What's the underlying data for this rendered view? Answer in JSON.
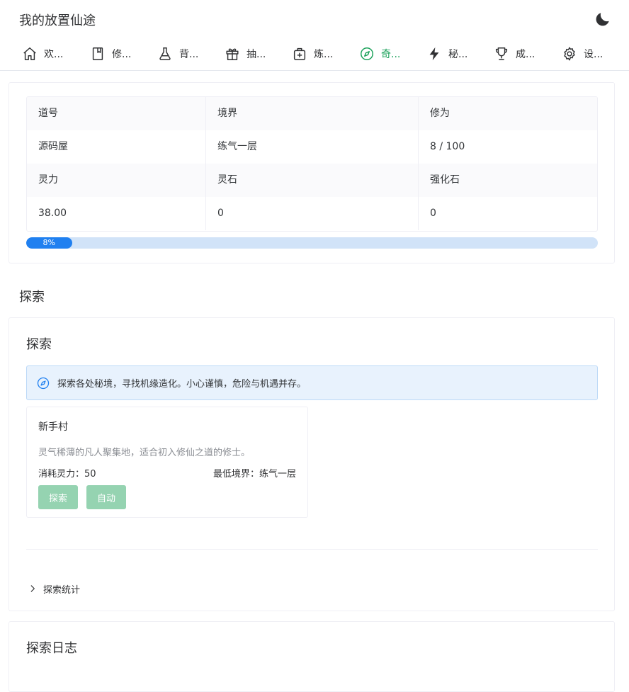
{
  "app": {
    "title": "我的放置仙途",
    "theme_icon": "moon-icon"
  },
  "nav": {
    "items": [
      {
        "label": "欢...",
        "icon": "home-icon"
      },
      {
        "label": "修...",
        "icon": "book-icon"
      },
      {
        "label": "背...",
        "icon": "flask-icon"
      },
      {
        "label": "抽...",
        "icon": "gift-icon"
      },
      {
        "label": "炼...",
        "icon": "medkit-icon"
      },
      {
        "label": "奇...",
        "icon": "compass-icon",
        "active": true
      },
      {
        "label": "秘...",
        "icon": "flash-icon"
      },
      {
        "label": "成...",
        "icon": "trophy-icon"
      },
      {
        "label": "设...",
        "icon": "gear-icon"
      }
    ],
    "active_color": "#18a058"
  },
  "stats": {
    "headers": [
      "道号",
      "境界",
      "修为"
    ],
    "values": [
      "源码屋",
      "练气一层",
      "8 / 100"
    ],
    "headers2": [
      "灵力",
      "灵石",
      "强化石"
    ],
    "values2": [
      "38.00",
      "0",
      "0"
    ],
    "progress": {
      "label": "8%",
      "percent": 8
    }
  },
  "section": {
    "title": "探索"
  },
  "explore": {
    "title": "探索",
    "alert": "探索各处秘境，寻找机缘造化。小心谨慎，危险与机遇并存。",
    "location": {
      "name": "新手村",
      "desc": "灵气稀薄的凡人聚集地，适合初入修仙之道的修士。",
      "cost": "消耗灵力：50",
      "min_realm": "最低境界：练气一层",
      "explore_btn": "探索",
      "auto_btn": "自动"
    },
    "stats_label": "探索统计"
  },
  "log": {
    "title": "探索日志"
  },
  "colors": {
    "primary": "#18a058",
    "info": "#2080f0",
    "button_disabled": "#95d3b1"
  }
}
